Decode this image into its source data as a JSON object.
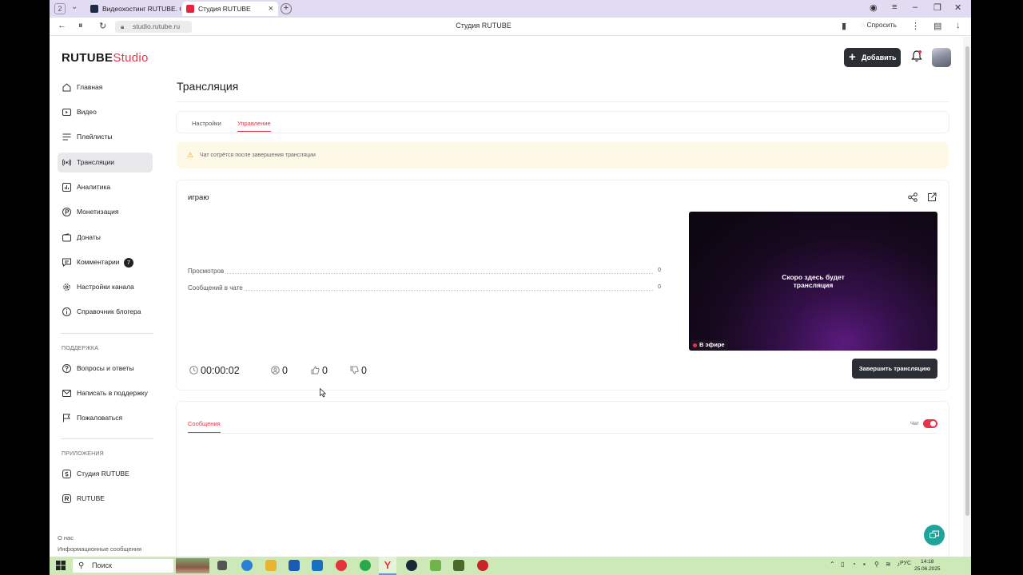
{
  "browser": {
    "tab_count": "2",
    "tabs": [
      {
        "title": "Видеохостинг RUTUBE. С"
      },
      {
        "title": "Студия RUTUBE"
      }
    ],
    "url": "studio.rutube.ru",
    "page_title": "Студия RUTUBE",
    "ask_label": "Спросить"
  },
  "header": {
    "logo_main": "RUTUBE",
    "logo_studio": "Studio",
    "add_label": "Добавить"
  },
  "sidebar": {
    "items": [
      {
        "label": "Главная",
        "icon": "home-icon"
      },
      {
        "label": "Видео",
        "icon": "video-icon"
      },
      {
        "label": "Плейлисты",
        "icon": "playlist-icon"
      },
      {
        "label": "Трансляции",
        "icon": "broadcast-icon"
      },
      {
        "label": "Аналитика",
        "icon": "analytics-icon"
      },
      {
        "label": "Монетизация",
        "icon": "ruble-icon"
      },
      {
        "label": "Донаты",
        "icon": "wallet-icon"
      },
      {
        "label": "Комментарии",
        "icon": "comment-icon",
        "badge": "7"
      },
      {
        "label": "Настройки канала",
        "icon": "gear-icon"
      },
      {
        "label": "Справочник блогера",
        "icon": "info-icon"
      }
    ],
    "support_heading": "ПОДДЕРЖКА",
    "support_items": [
      {
        "label": "Вопросы и ответы",
        "icon": "question-icon"
      },
      {
        "label": "Написать в поддержку",
        "icon": "mail-icon"
      },
      {
        "label": "Пожаловаться",
        "icon": "flag-icon"
      }
    ],
    "apps_heading": "ПРИЛОЖЕНИЯ",
    "apps_items": [
      {
        "label": "Студия RUTUBE",
        "icon": "studio-app-icon"
      },
      {
        "label": "RUTUBE",
        "icon": "rutube-app-icon"
      }
    ],
    "footer_links": [
      "О нас",
      "Информационные сообщения"
    ]
  },
  "main": {
    "title": "Трансляция",
    "tabs": [
      "Настройки",
      "Управление"
    ],
    "warning": "Чат сотрётся после завершения трансляции",
    "stream": {
      "name": "играю",
      "stats": [
        {
          "label": "Просмотров",
          "value": "0"
        },
        {
          "label": "Сообщений в чате",
          "value": "0"
        }
      ],
      "preview_text_line1": "Скоро здесь будет",
      "preview_text_line2": "трансляция",
      "live_label": "В эфире",
      "timer": "00:00:02",
      "viewers": "0",
      "likes": "0",
      "dislikes": "0",
      "end_button": "Завершить трансляцию"
    },
    "chat": {
      "tab_label": "Сообщения",
      "toggle_label": "Чат",
      "toggle_on": true
    }
  },
  "taskbar": {
    "search_placeholder": "Поиск",
    "lang": "РУС",
    "time": "14:18",
    "date": "25.06.2025"
  },
  "colors": {
    "accent": "#e6344a",
    "dark_button": "#2b2f35",
    "warning_bg": "#fdf9e6",
    "help_fab": "#1fa39a"
  }
}
